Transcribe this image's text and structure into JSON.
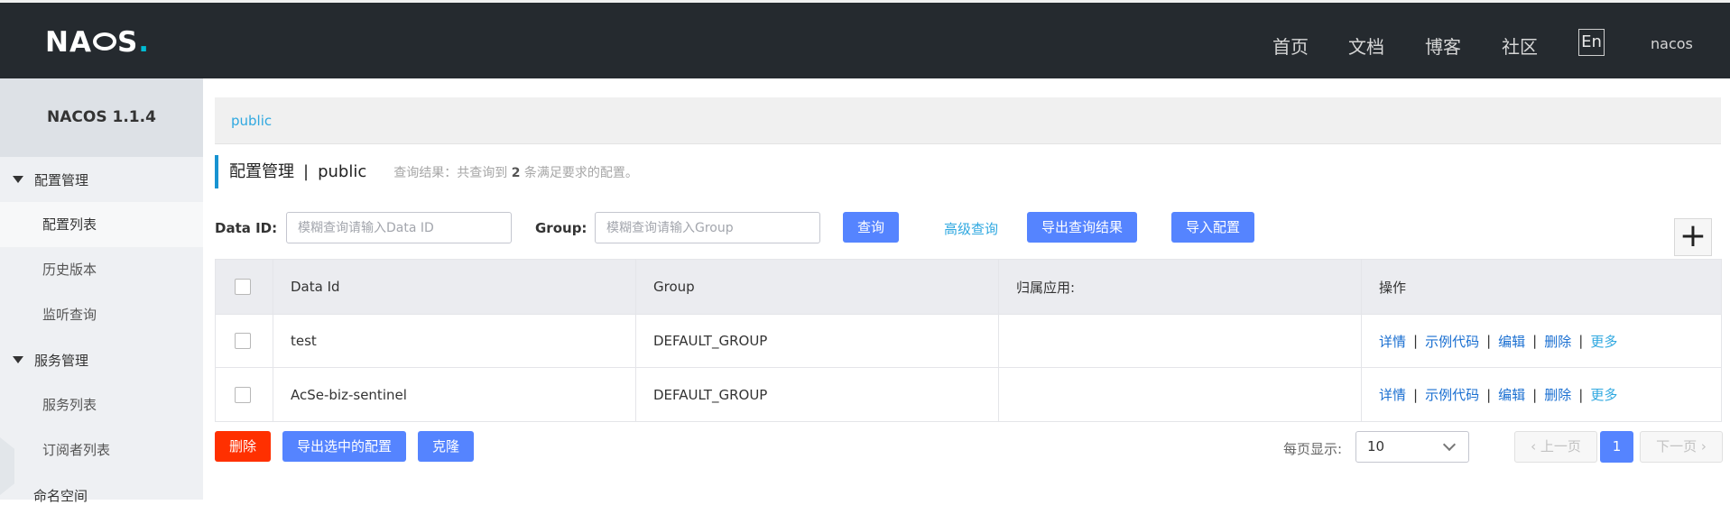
{
  "header": {
    "logo": {
      "pre": "NA",
      "mid": "C",
      "post": "S",
      "dot": "."
    },
    "nav": [
      "首页",
      "文档",
      "博客",
      "社区"
    ],
    "lang": "En",
    "user": "nacos"
  },
  "sidebar": {
    "version": "NACOS 1.1.4",
    "groups": [
      {
        "label": "配置管理",
        "items": [
          "配置列表",
          "历史版本",
          "监听查询"
        ]
      },
      {
        "label": "服务管理",
        "items": [
          "服务列表",
          "订阅者列表"
        ]
      }
    ],
    "namespace": "命名空间"
  },
  "breadcrumb": "public",
  "title": {
    "main": "配置管理",
    "sep": "|",
    "namespace": "public",
    "hint_pre": "查询结果：共查询到",
    "hint_count": "2",
    "hint_post": "条满足要求的配置。"
  },
  "filters": {
    "data_id_label": "Data ID:",
    "data_id_placeholder": "模糊查询请输入Data ID",
    "group_label": "Group:",
    "group_placeholder": "模糊查询请输入Group",
    "query": "查询",
    "advanced": "高级查询",
    "export_result": "导出查询结果",
    "import": "导入配置",
    "add": "+"
  },
  "table": {
    "columns": [
      "Data Id",
      "Group",
      "归属应用:",
      "操作"
    ],
    "rows": [
      {
        "data_id": "test",
        "group": "DEFAULT_GROUP",
        "app": ""
      },
      {
        "data_id": "AcSe-biz-sentinel",
        "group": "DEFAULT_GROUP",
        "app": ""
      }
    ],
    "ops": {
      "detail": "详情",
      "sample": "示例代码",
      "edit": "编辑",
      "delete": "删除",
      "more": "更多",
      "sep": "|"
    }
  },
  "footer": {
    "delete": "删除",
    "export_selected": "导出选中的配置",
    "clone": "克隆",
    "page_size_label": "每页显示:",
    "page_size": "10",
    "prev": "上一页",
    "current_page": "1",
    "next": "下一页"
  },
  "colors": {
    "topbar": "#252a2f",
    "accent": "#5584ff",
    "danger": "#ff3000",
    "link": "#2fa8e0"
  }
}
